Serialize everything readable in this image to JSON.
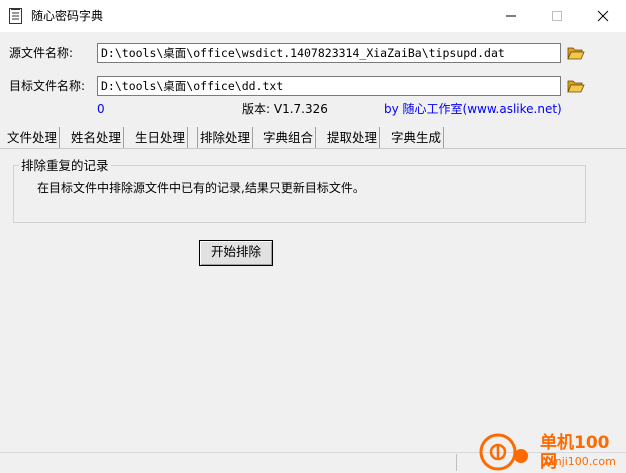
{
  "window": {
    "title": "随心密码字典",
    "controls": {
      "minimize": "minimize-icon",
      "maximize": "maximize-icon",
      "close": "close-icon"
    }
  },
  "form": {
    "source_label": "源文件名称:",
    "source_value": "D:\\tools\\桌面\\office\\wsdict.1407823314_XiaZaiBa\\tipsupd.dat",
    "target_label": "目标文件名称:",
    "target_value": "D:\\tools\\桌面\\office\\dd.txt",
    "counter": "0",
    "version": "版本: V1.7.326",
    "credit": "by 随心工作室(www.aslike.net)"
  },
  "tabs": [
    {
      "label": "文件处理"
    },
    {
      "label": "姓名处理"
    },
    {
      "label": "生日处理"
    },
    {
      "label": "排除处理",
      "active": true
    },
    {
      "label": "字典组合"
    },
    {
      "label": "提取处理"
    },
    {
      "label": "字典生成"
    }
  ],
  "panel": {
    "group_title": "排除重复的记录",
    "description": "在目标文件中排除源文件中已有的记录,结果只更新目标文件。",
    "start_button": "开始排除"
  },
  "watermark": {
    "brand": "单机100网",
    "url": "danji100.com"
  },
  "colors": {
    "accent_blue": "#0000ff",
    "watermark_orange": "#ff6a00",
    "folder_yellow": "#f2c94c"
  }
}
